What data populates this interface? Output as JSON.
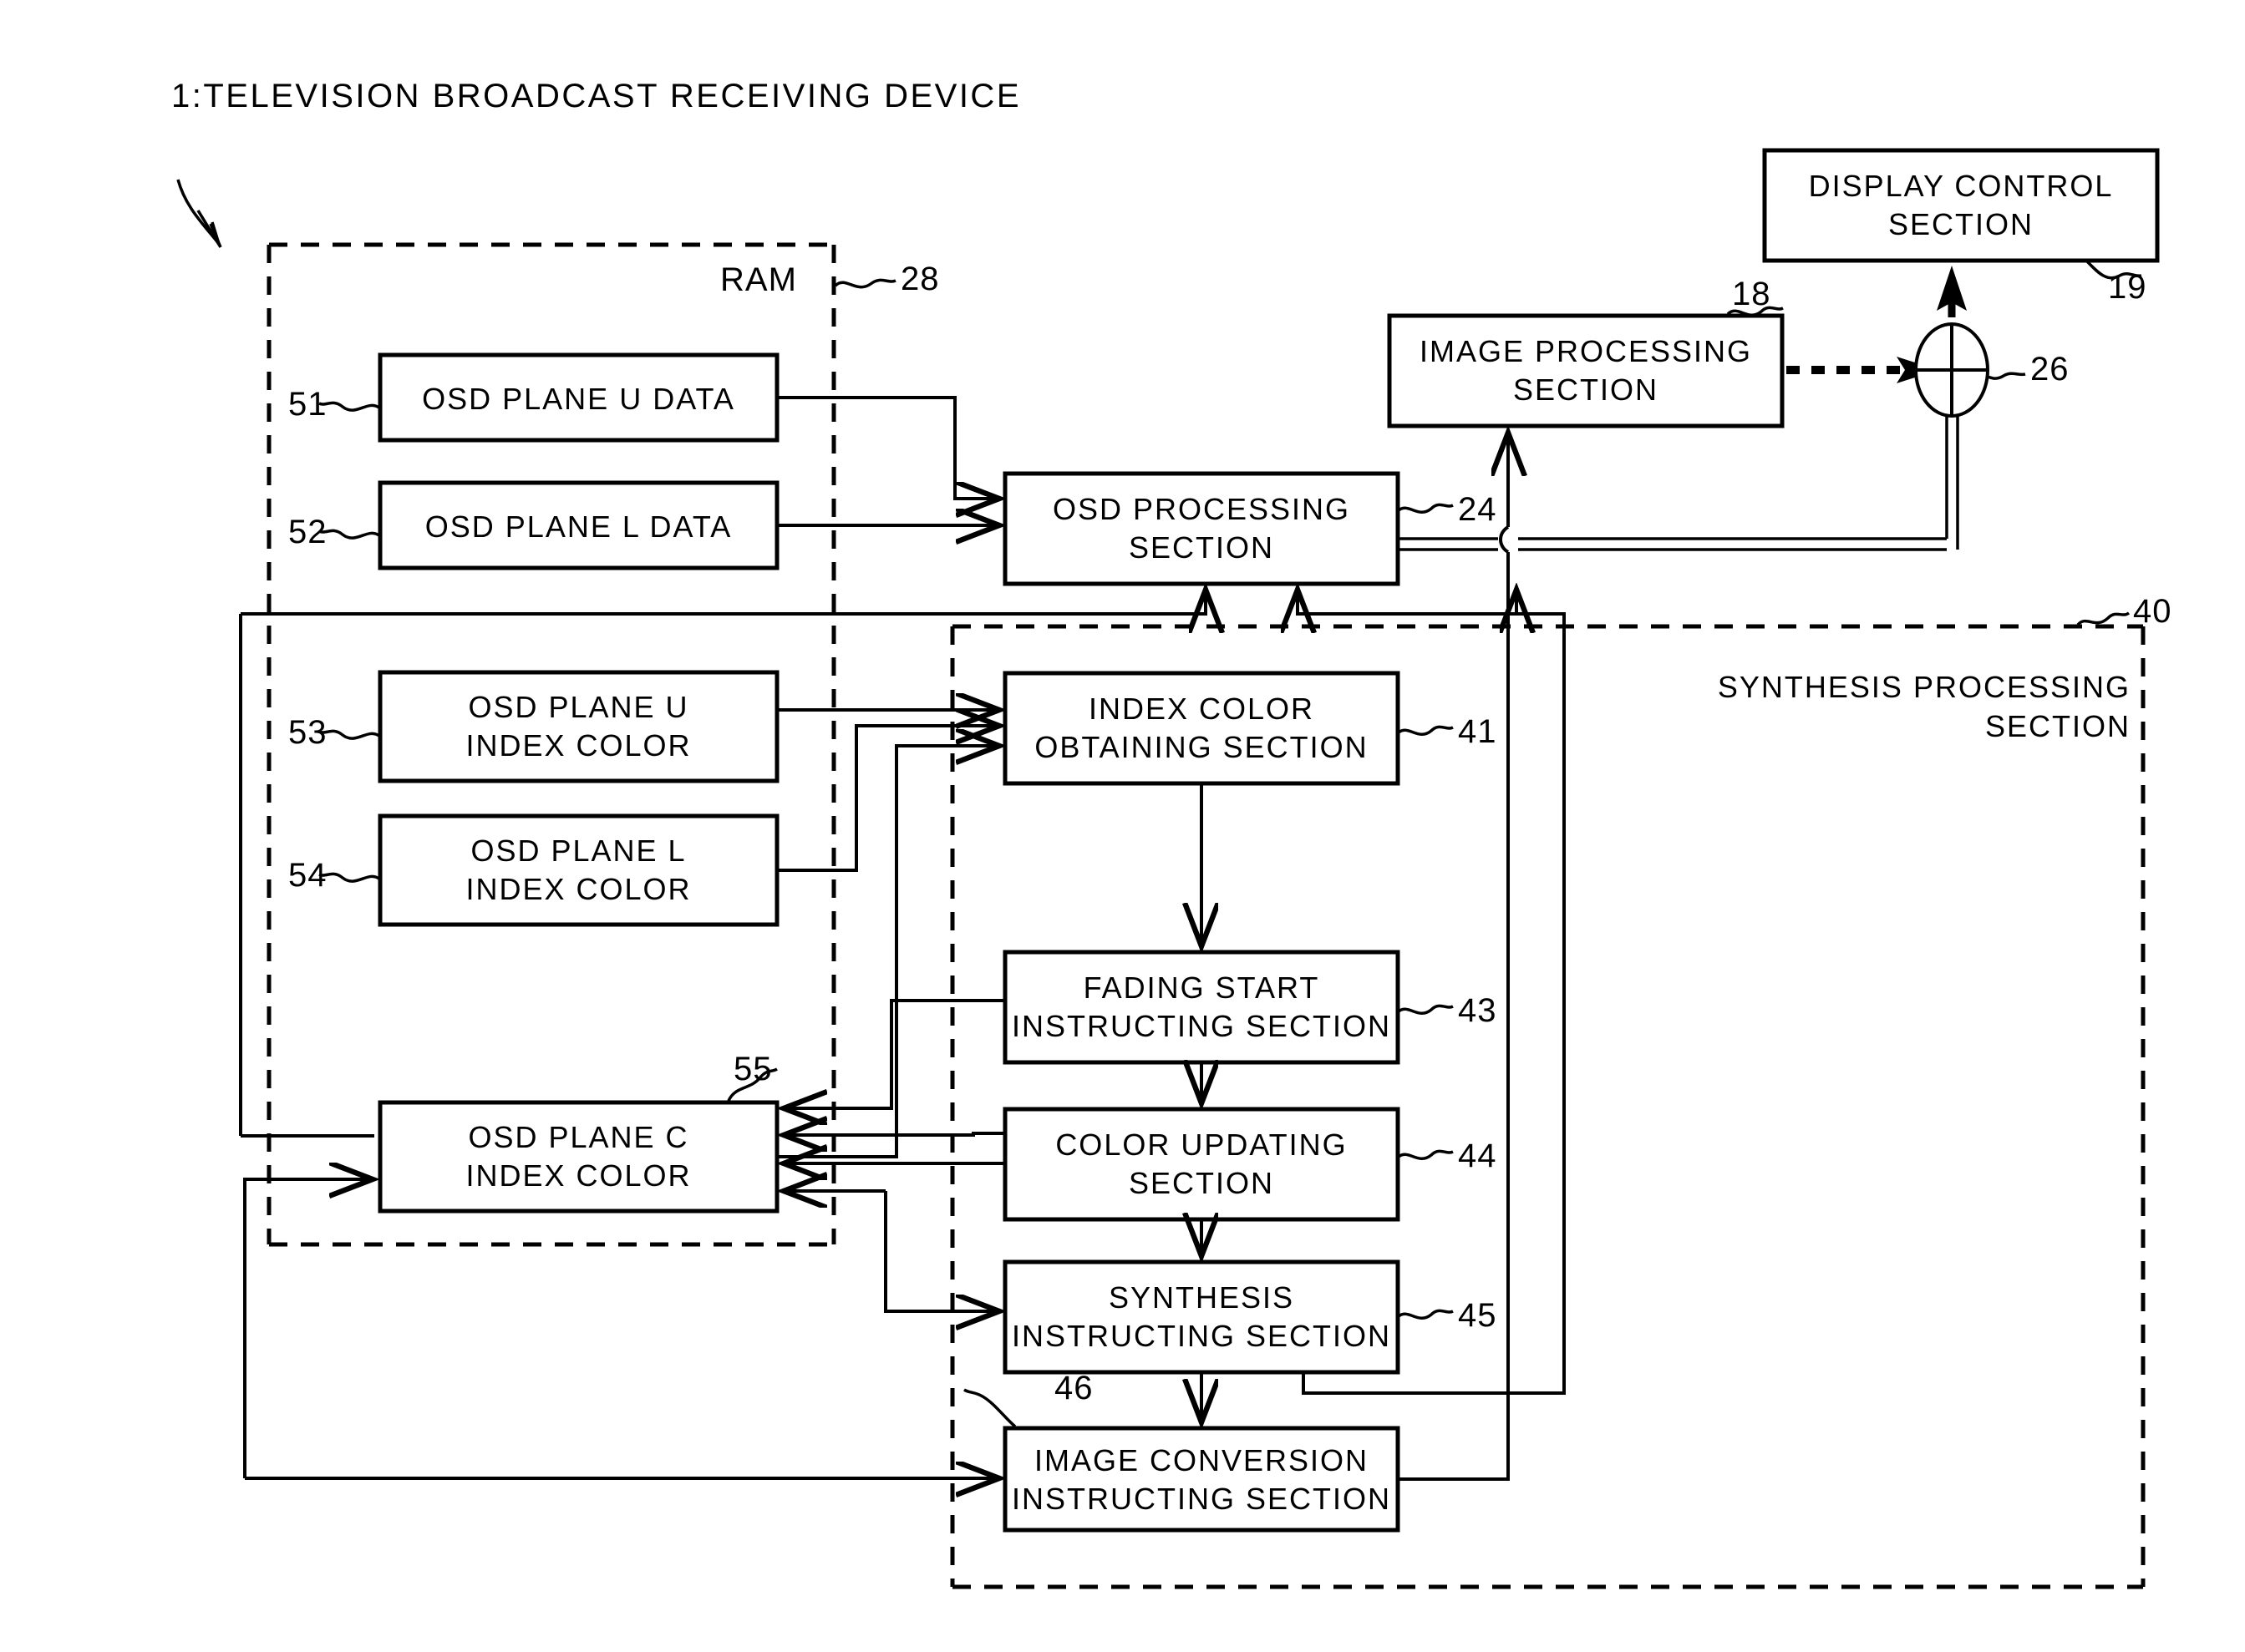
{
  "figure": {
    "title": "1:TELEVISION BROADCAST RECEIVING DEVICE",
    "ram_label": "RAM",
    "ram_ref": "28",
    "synthesis_label": "SYNTHESIS PROCESSING\nSECTION",
    "synthesis_ref": "40"
  },
  "blocks": [
    {
      "id": "osd_plane_u_data",
      "label": "OSD PLANE U DATA",
      "ref": "51"
    },
    {
      "id": "osd_plane_l_data",
      "label": "OSD PLANE L DATA",
      "ref": "52"
    },
    {
      "id": "osd_plane_u_index",
      "label": "OSD PLANE U\nINDEX COLOR",
      "ref": "53"
    },
    {
      "id": "osd_plane_l_index",
      "label": "OSD PLANE L\nINDEX COLOR",
      "ref": "54"
    },
    {
      "id": "osd_plane_c_index",
      "label": "OSD PLANE C\nINDEX COLOR",
      "ref": "55"
    },
    {
      "id": "osd_processing",
      "label": "OSD PROCESSING\nSECTION",
      "ref": "24"
    },
    {
      "id": "index_color_obtain",
      "label": "INDEX COLOR\nOBTAINING SECTION",
      "ref": "41"
    },
    {
      "id": "fading_start",
      "label": "FADING START\nINSTRUCTING SECTION",
      "ref": "43"
    },
    {
      "id": "color_updating",
      "label": "COLOR UPDATING\nSECTION",
      "ref": "44"
    },
    {
      "id": "synthesis_instruct",
      "label": "SYNTHESIS\nINSTRUCTING SECTION",
      "ref": "45"
    },
    {
      "id": "image_conversion",
      "label": "IMAGE CONVERSION\nINSTRUCTING SECTION",
      "ref": "46"
    },
    {
      "id": "image_processing",
      "label": "IMAGE PROCESSING\nSECTION",
      "ref": "18"
    },
    {
      "id": "display_control",
      "label": "DISPLAY CONTROL\nSECTION",
      "ref": "19"
    }
  ],
  "junction": {
    "id": "synthesis_node",
    "ref": "26",
    "icon": "summing-junction-icon"
  }
}
